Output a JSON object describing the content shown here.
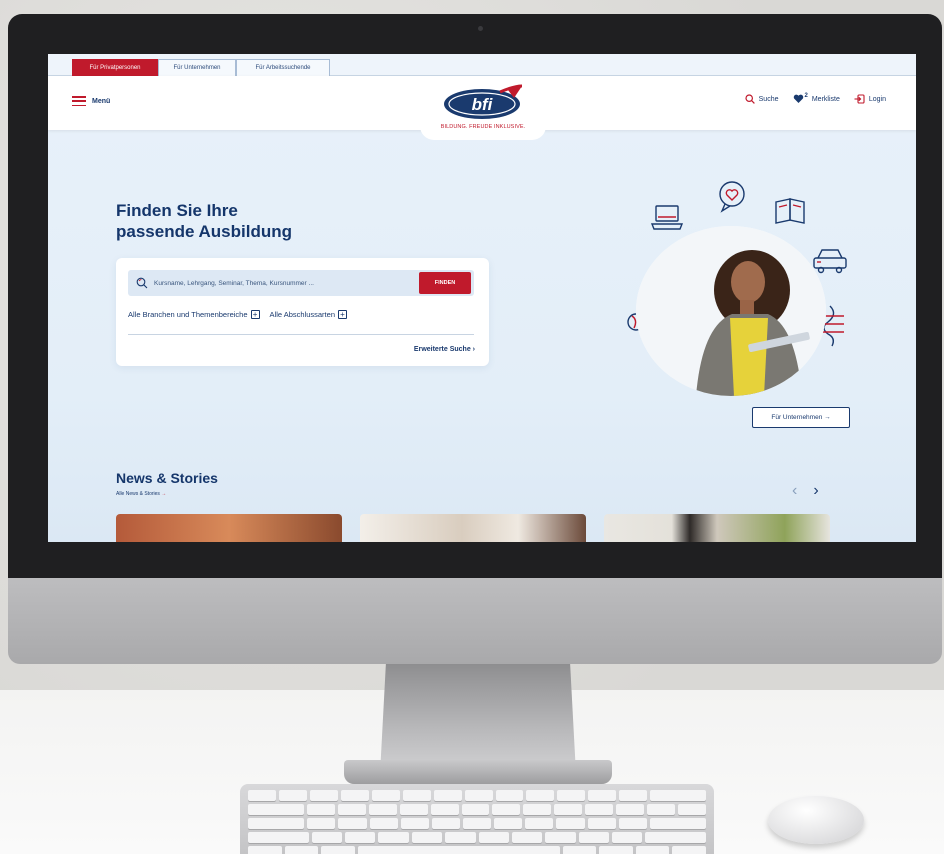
{
  "tabs": [
    {
      "label": "Für Privatpersonen",
      "active": true
    },
    {
      "label": "Für Unternehmen",
      "active": false
    },
    {
      "label": "Für Arbeitssuchende",
      "active": false
    }
  ],
  "header": {
    "menu_label": "Menü",
    "logo_text": "bfi",
    "logo_tagline": "BILDUNG. FREUDE INKLUSIVE.",
    "search_label": "Suche",
    "merkliste_label": "Merkliste",
    "merkliste_count": "2",
    "login_label": "Login"
  },
  "hero": {
    "title_line1": "Finden Sie Ihre",
    "title_line2": "passende Ausbildung",
    "unternehmen_button": "Für Unternehmen →"
  },
  "search": {
    "placeholder": "Kursname, Lehrgang, Seminar, Thema, Kursnummer ...",
    "button_label": "FINDEN",
    "filter_branches": "Alle Branchen und Themenbereiche",
    "filter_degrees": "Alle Abschlussarten",
    "advanced_label": "Erweiterte Suche  ›"
  },
  "news": {
    "title": "News & Stories",
    "all_link": "Alle News & Stories",
    "all_link_arrow": "→",
    "prev": "‹",
    "next": "›"
  },
  "colors": {
    "brand_red": "#c01a2c",
    "brand_navy": "#1a3a6e"
  }
}
